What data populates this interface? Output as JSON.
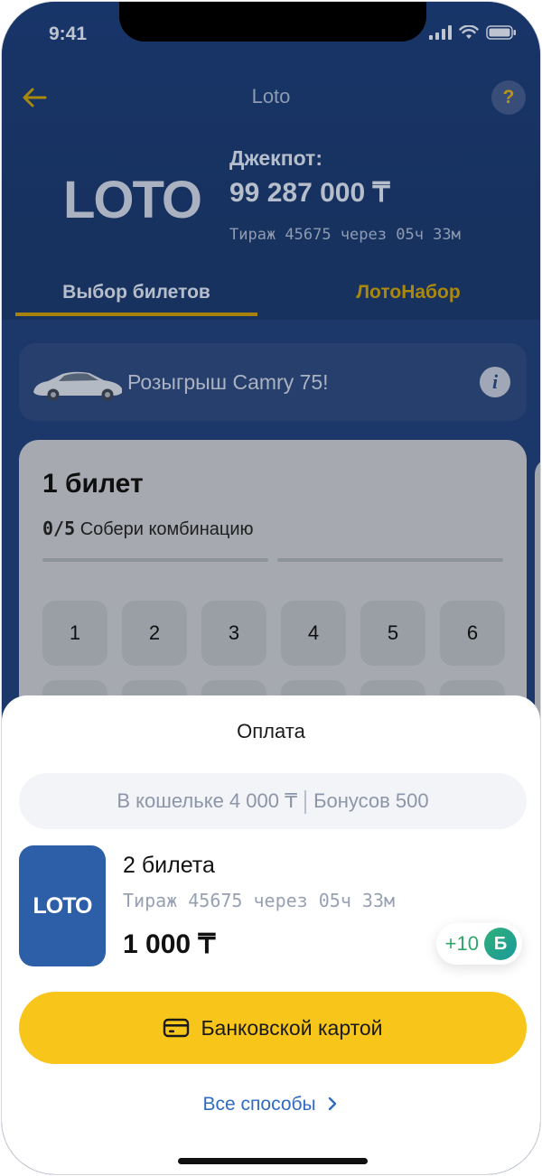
{
  "status": {
    "time": "9:41"
  },
  "nav": {
    "title": "Loto"
  },
  "header": {
    "logo": "LOTO",
    "jackpot_label": "Джекпот:",
    "jackpot_value": "99 287 000 ₸",
    "draw_info": "Тираж 45675 через 05ч  33м"
  },
  "tabs": [
    {
      "label": "Выбор билетов",
      "active": true
    },
    {
      "label": "ЛотоНабор",
      "active": false
    }
  ],
  "promo": {
    "text": "Розыгрыш Camry 75!"
  },
  "ticket": {
    "title": "1 билет",
    "progress_count": "0/5",
    "progress_text": "Собери комбинацию",
    "numbers": [
      "1",
      "2",
      "3",
      "4",
      "5",
      "6"
    ]
  },
  "sheet": {
    "title": "Оплата",
    "wallet_balance": "В кошельке 4 000 ₸",
    "wallet_bonus": "Бонусов 500",
    "order": {
      "logo": "LOTO",
      "count": "2 билета",
      "draw": "Тираж 45675 через 05ч  33м",
      "price": "1 000 ₸",
      "bonus": "+10",
      "bonus_badge": "Б"
    },
    "pay_button": "Банковской картой",
    "all_methods": "Все способы"
  },
  "colors": {
    "brand_blue": "#1b3a72",
    "accent_yellow": "#f8c61a",
    "link_blue": "#2f6bc0",
    "bonus_green": "#2fa66a"
  }
}
